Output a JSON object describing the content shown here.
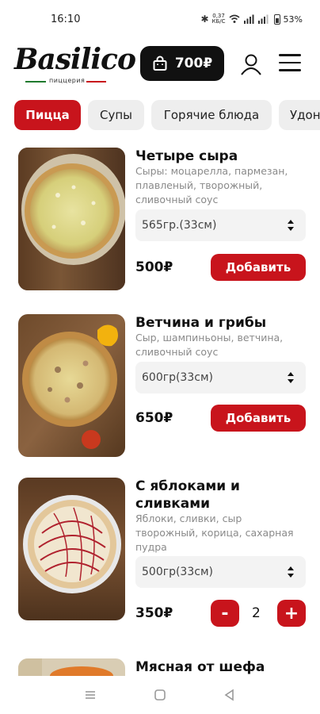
{
  "status": {
    "time": "16:10",
    "net_speed_value": "0,37",
    "net_speed_unit": "КБ/С",
    "battery": "53%"
  },
  "header": {
    "logo_name": "Basilico",
    "logo_subtitle": "пиццерия",
    "cart_total": "700₽"
  },
  "categories": [
    {
      "label": "Пицца",
      "active": true
    },
    {
      "label": "Супы",
      "active": false
    },
    {
      "label": "Горячие блюда",
      "active": false
    },
    {
      "label": "Удон",
      "active": false
    }
  ],
  "products": [
    {
      "title": "Четыре сыра",
      "description": "Сыры: моцарелла, пармезан, плавленый, творожный, сливочный соус",
      "size": "565гр.(33см)",
      "price": "500₽",
      "button": "Добавить"
    },
    {
      "title": "Ветчина и грибы",
      "description": "Сыр, шампиньоны, ветчина, сливочный соус",
      "size": "600гр(33см)",
      "price": "650₽",
      "button": "Добавить"
    },
    {
      "title": "С яблоками и сливками",
      "description": "Яблоки, сливки, сыр творожный, корица, сахарная пудра",
      "size": "500гр(33см)",
      "price": "350₽",
      "minus": "-",
      "quantity": "2",
      "plus": "+"
    },
    {
      "title": "Мясная от шефа"
    }
  ],
  "colors": {
    "accent": "#c8141c",
    "dark": "#111111",
    "muted": "#8a8a8a"
  }
}
